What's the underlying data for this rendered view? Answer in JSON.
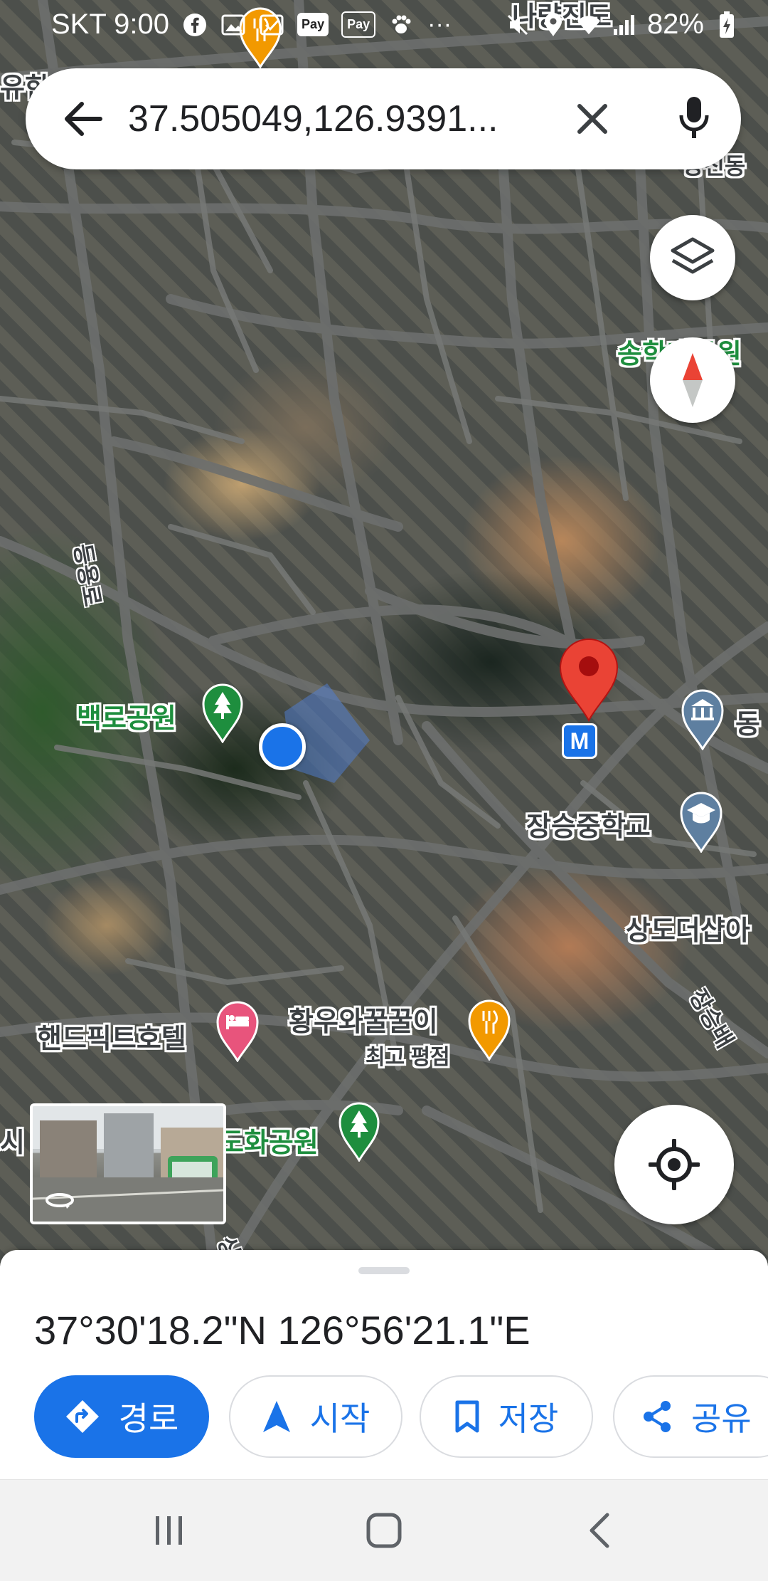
{
  "status_bar": {
    "carrier_time": "SKT 9:00",
    "battery": "82%",
    "icons": [
      "facebook-icon",
      "image-icon",
      "image-check-icon",
      "pay-badge-icon",
      "pay-badge-icon",
      "paw-icon",
      "more-dots-icon",
      "mute-icon",
      "location-icon",
      "wifi-icon",
      "signal-icon",
      "battery-charging-icon"
    ],
    "pay_badge_1": "Pay",
    "pay_badge_2": "Pay"
  },
  "search": {
    "query": "37.505049,126.9391..."
  },
  "map": {
    "labels": {
      "park_baekro": "백로공원",
      "middle_school": "장승중학교",
      "sangdo_the_sharp": "상도더샵아",
      "hotel": "핸드픽트호텔",
      "restaurant": "황우와꿀꿀이",
      "restaurant_sub": "최고 평점",
      "park_dohwa": "도화공원",
      "songhak": "송학대공원",
      "top_right": "광진동",
      "top_center": "나량진도",
      "top_left": "유한",
      "east_partial": "동",
      "left_partial": "시",
      "road_1": "등용로",
      "road_2": "장승배",
      "road_3": "상"
    },
    "metro_badge": "M",
    "accent_pin": "#ea4335",
    "accent_blue_dot": "#1a73e8"
  },
  "bottom_sheet": {
    "coordinates": "37°30'18.2\"N 126°56'21.1\"E",
    "actions": {
      "directions": "경로",
      "start": "시작",
      "save": "저장",
      "share": "공유"
    }
  },
  "colors": {
    "primary": "#1a73e8",
    "park_green": "#1e8e3e",
    "food_orange": "#f29900",
    "hotel_pink": "#e8547c",
    "school_blue": "#5e7fa0"
  }
}
